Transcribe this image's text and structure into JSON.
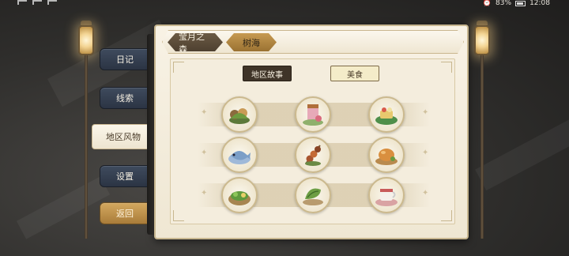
{
  "status_bar": {
    "battery": "83%",
    "time": "12:08"
  },
  "regions": [
    {
      "label": "莹月之森",
      "active": false
    },
    {
      "label": "树海",
      "active": true
    }
  ],
  "categories": [
    {
      "label": "地区故事",
      "active": true
    },
    {
      "label": "美食",
      "active": false
    }
  ],
  "menu": {
    "diary": "日记",
    "clues": "线索",
    "local_customs": "地区风物",
    "settings": "设置",
    "back": "返回"
  },
  "food_items": [
    {
      "icon": "herb-bundle-dish-icon"
    },
    {
      "icon": "jam-jar-dish-icon"
    },
    {
      "icon": "leaf-cake-dish-icon"
    },
    {
      "icon": "fish-plate-dish-icon"
    },
    {
      "icon": "meat-skewer-dish-icon"
    },
    {
      "icon": "roast-chicken-dish-icon"
    },
    {
      "icon": "green-salad-dish-icon"
    },
    {
      "icon": "leaf-wrapped-dish-icon"
    },
    {
      "icon": "tea-cup-dish-icon"
    }
  ],
  "colors": {
    "panel": "#f4eddd",
    "accent_gold": "#c79a52",
    "tab_dark": "#3f3428",
    "menu_blue": "#2b3444"
  }
}
